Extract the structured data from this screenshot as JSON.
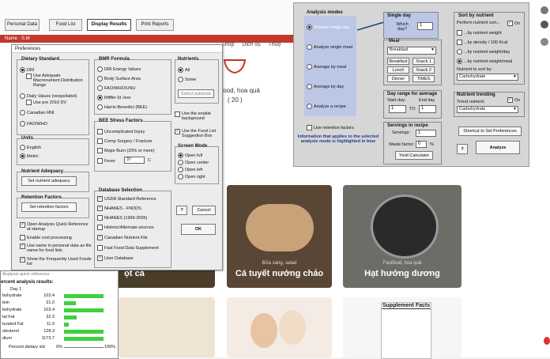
{
  "app_tabs": [
    "Personal Data",
    "Food List",
    "Display Results",
    "Print Reports"
  ],
  "name_bar": "Name : S.M",
  "web": {
    "nav": [
      "Shop",
      "Dịch vụ",
      "Thuộ"
    ],
    "partial_text": "food, hoa quả",
    "count": "( 20 )",
    "cards": [
      {
        "tag": "",
        "title": "ọt cà"
      },
      {
        "tag": "Bữa sáng, salad",
        "title": "Cá tuyết nướng chảo"
      },
      {
        "tag": "Fastfood, hoa quả",
        "title": "Hạt hướng dương"
      }
    ],
    "supplement_label": "Supplement Facts"
  },
  "prefs": {
    "title": "Preferences",
    "dietary_standard": {
      "label": "Dietary Standard",
      "options": [
        "DRI",
        "Use Adequate Macronutrient Distribution Range",
        "Daily Values (recipe/label)",
        "Use pre 2016 DV",
        "Canadian RNI",
        "FAO/WHO"
      ]
    },
    "bmr": {
      "label": "BMR Formula",
      "options": [
        "DRI Energy Values",
        "Body Surface Area",
        "FAO/WHO/UNU",
        "Mifflin-St Jeor",
        "Harris-Benedict (BEE)"
      ]
    },
    "nutrients": {
      "label": "Nutrients",
      "options": [
        "All",
        "Some"
      ],
      "button": "Select nutrients"
    },
    "bee_stress": {
      "label": "BEE Stress Factors",
      "options": [
        "Uncomplicated Injury",
        "Comp Surgery / Fracture",
        "Major Burn (20% or more)",
        "Fever"
      ],
      "fever_value": "37",
      "fever_unit": "C"
    },
    "extra_checks": [
      "Use the enable background",
      "Use the Food List Suggestion Box"
    ],
    "units": {
      "label": "Units",
      "options": [
        "English",
        "Metric"
      ]
    },
    "screen_mode": {
      "label": "Screen Mode",
      "options": [
        "Open full",
        "Open center",
        "Open left",
        "Open right"
      ]
    },
    "adequacy": {
      "label": "Nutrient Adequacy",
      "button": "Set nutrient adequacy"
    },
    "retention": {
      "label": "Retention Factors",
      "button": "Set retention factors"
    },
    "misc_checks": [
      "Open Analysis Quick Reference at startup",
      "Enable cost processing",
      "Use name in personal data as file name for food lists",
      "Show the Frequently Used Foods list"
    ],
    "database": {
      "label": "Database Selection",
      "options": [
        "USDA Standard Reference",
        "NHANES - FNDDS",
        "NHANES (1999-2005)",
        "Historic/Alternate sources",
        "Canadian Nutrient File",
        "Fast Food Data Supplement",
        "User Database"
      ]
    },
    "buttons": {
      "help": "?",
      "cancel": "Cancel",
      "ok": "OK"
    }
  },
  "analysis": {
    "modes": {
      "label": "Analysis modes",
      "options": [
        "Analyze single day",
        "Analyze single meal",
        "Average by meal",
        "Average by day",
        "Analyze a recipe"
      ]
    },
    "single_day": {
      "label": "Single day",
      "which": "Which day?",
      "value": "1"
    },
    "meal": {
      "label": "Meal",
      "selected": "Breakfast",
      "buttons": [
        "Breakfast",
        "Snack 1",
        "Lunch",
        "Snack 2",
        "Dinner",
        "TIMES"
      ]
    },
    "day_range": {
      "label": "Day range for average",
      "start_label": "Start day:",
      "end_label": "End day",
      "start": "1",
      "to": "TO",
      "end": "1"
    },
    "retention_check": "Use retention factors",
    "note": "Information that applies to the selected analysis mode is highlighted in blue",
    "servings": {
      "label": "Servings in recipe",
      "servings_label": "Servings:",
      "servings_value": "1",
      "waste_label": "Waste factor:",
      "waste_value": "0",
      "waste_unit": "%",
      "button": "Yield Calculator"
    },
    "sort": {
      "label": "Sort by nutrient",
      "perform": "Perform nutrient sort...",
      "on": "On",
      "options": [
        "...by nutrient weight",
        "...by density / 100 Kcal",
        "...by nutrient weight/day",
        "...by nutrient weight/meal"
      ],
      "sort_label": "Nutrient to sort by:",
      "sort_value": "Carbohydrate"
    },
    "trending": {
      "label": "Nutrient trending",
      "trend_label": "Trend nutrient:",
      "on": "On",
      "value": "Carbohydrate"
    },
    "shortcut": "Shortcut to Set Preferences",
    "help": "?",
    "analyze": "Analyze"
  },
  "quick_ref": {
    "title": "Analysis quick reference",
    "heading": "ercent analysis results:",
    "day": "Day 1",
    "rows": [
      {
        "label": "bohydrate",
        "value": "103.4",
        "pct": 1.0
      },
      {
        "label": "tein",
        "value": "31.0",
        "pct": 0.3
      },
      {
        "label": "bohydrate",
        "value": "103.4",
        "pct": 1.0
      },
      {
        "label": "tal Fat",
        "value": "32.3",
        "pct": 0.32
      },
      {
        "label": "turated Fat",
        "value": "11.9",
        "pct": 0.12
      },
      {
        "label": "olesterol",
        "value": "128.3",
        "pct": 1.0
      },
      {
        "label": "dium",
        "value": "1173.7",
        "pct": 1.0
      }
    ],
    "footer": "Percent dietary std",
    "scale_min": "0%",
    "scale_max": "100%"
  },
  "colors": {
    "bar": "#3dd13d",
    "accent_blue": "#1f3a93",
    "mode_highlight": "#bcc7e6",
    "name_bar": "#c0392b"
  }
}
